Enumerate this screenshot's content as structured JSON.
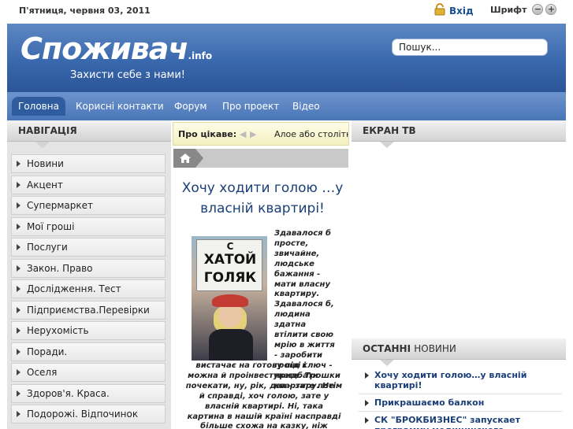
{
  "topbar": {
    "date": "П'ятниця, червня 03, 2011",
    "login_label": "Вхід",
    "font_label": "Шрифт",
    "font_decrease": "−",
    "font_increase": "+"
  },
  "header": {
    "logo": "Споживач",
    "logo_suffix": ".info",
    "slogan": "Захисти себе з нами!",
    "search_value": "Пошук..."
  },
  "nav": {
    "items": [
      "Головна",
      "Корисні контакти",
      "Форум",
      "Про проект",
      "Відео"
    ],
    "active": "Головна"
  },
  "left": {
    "title": "НАВІГАЦІЯ",
    "items": [
      "Новини",
      "Акцент",
      "Супермаркет",
      "Мої гроші",
      "Послуги",
      "Закон. Право",
      "Дослідження. Тест",
      "Підприємства.Перевірки",
      "Нерухомість",
      "Поради.",
      "Оселя",
      "Здоров'я. Краса.",
      "Подорожі. Відпочинок"
    ]
  },
  "center": {
    "ticker_label": "Про цікаве:",
    "ticker_text": "Алое або столітник",
    "article": {
      "title": "Хочу ходити голою …у власній квартирі!",
      "photo_sign": [
        "С",
        "ХАТОЙ",
        "ГОЛЯК"
      ],
      "text_narrow": "Здавалося б просте, звичайне, людське бажання - мати власну квартиру. Здавалося б, людина здатна втілити свою мрію в життя - заробити гроші і придбати квартиру. Не",
      "text_wide": "вистачає на готову під ключ - можна й проінвестувати. Трошки почекати, ну, рік, два - зате потім й справді, хоч голою, зате у власній квартирі. Ні, така картина в нашій країні насправді більше схожа на казку, ніж"
    }
  },
  "right": {
    "tv_title": "ЕКРАН ТВ",
    "latest_title_bold": "ОСТАННІ",
    "latest_title_rest": "НОВИНИ",
    "latest": [
      "Хочу ходити голою…у власній квартирі!",
      "Прикрашаємо балкон",
      "СК \"БРОКБИЗНЕС\" запускает программу медицинского страхования \"Доктор"
    ]
  },
  "colors": {
    "header": "#3a68ad",
    "nav": "#5b85c2",
    "title_blue": "#1a3f78",
    "ticker_bg": "#f9f5d0"
  },
  "icons": [
    "lock-icon",
    "home-icon",
    "arrow-left-icon",
    "arrow-right-icon",
    "bullet-arrow-icon"
  ]
}
